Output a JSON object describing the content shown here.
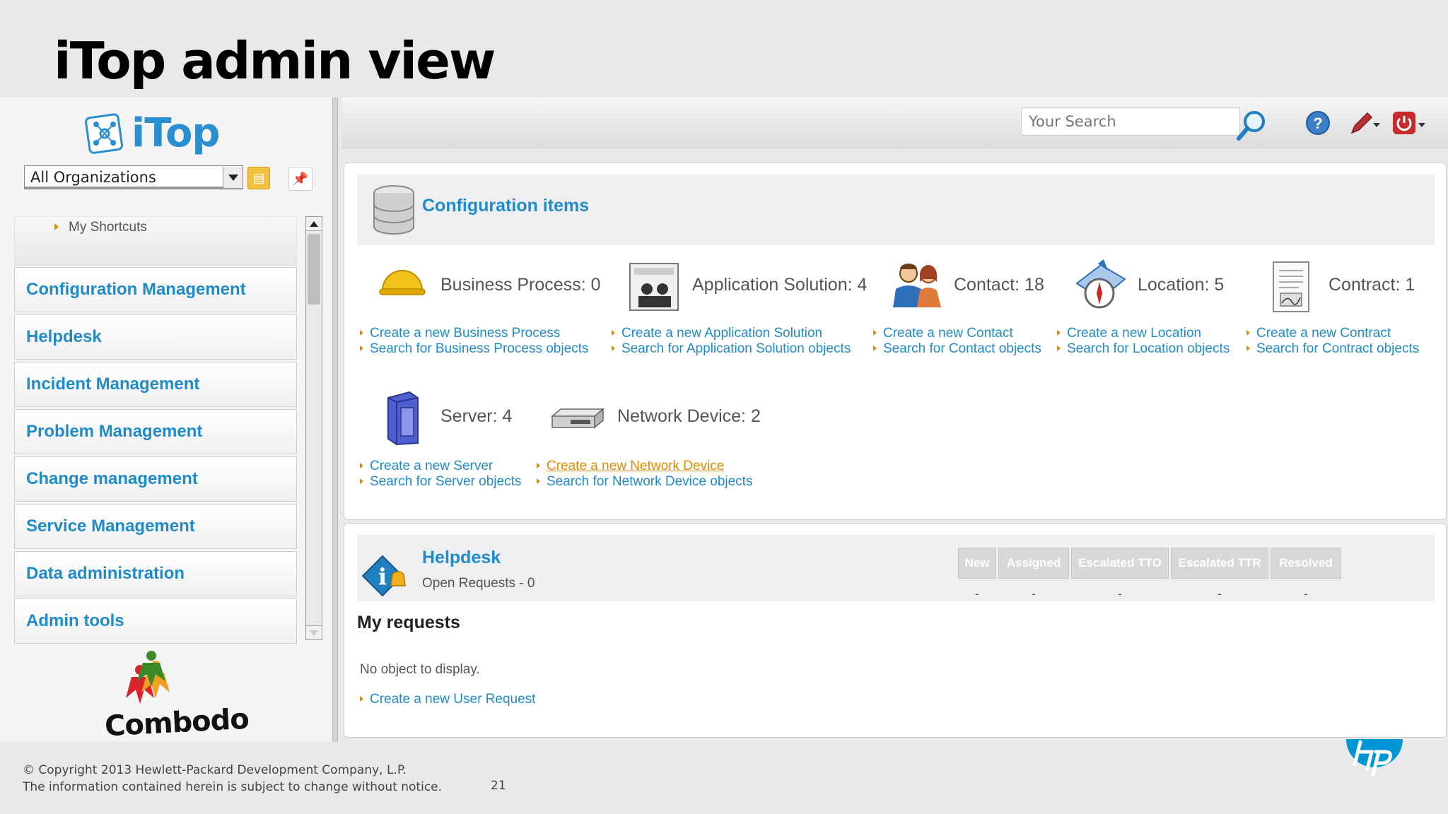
{
  "slide": {
    "title": "iTop admin view",
    "copyright": "© Copyright 2013 Hewlett-Packard Development Company, L.P.",
    "notice": "The information contained herein is subject to change without notice.",
    "page_number": "21"
  },
  "left_pane": {
    "logo_text": "iTop",
    "org_select": "All Organizations",
    "shortcuts_label": "My Shortcuts",
    "menu": [
      {
        "label": "Configuration Management"
      },
      {
        "label": "Helpdesk"
      },
      {
        "label": "Incident Management"
      },
      {
        "label": "Problem Management"
      },
      {
        "label": "Change management"
      },
      {
        "label": "Service Management"
      },
      {
        "label": "Data administration"
      },
      {
        "label": "Admin tools"
      }
    ],
    "combodo_text": "Combodo"
  },
  "topbar": {
    "search_placeholder": "Your Search"
  },
  "config_items": {
    "title": "Configuration items",
    "items": [
      {
        "label": "Business Process: 0",
        "create": "Create a new Business Process",
        "search": "Search for Business Process objects"
      },
      {
        "label": "Application Solution: 4",
        "create": "Create a new Application Solution",
        "search": "Search for Application Solution objects"
      },
      {
        "label": "Contact: 18",
        "create": "Create a new Contact",
        "search": "Search for Contact objects"
      },
      {
        "label": "Location: 5",
        "create": "Create a new Location",
        "search": "Search for Location objects"
      },
      {
        "label": "Contract: 1",
        "create": "Create a new Contract",
        "search": "Search for Contract objects"
      },
      {
        "label": "Server: 4",
        "create": "Create a new Server",
        "search": "Search for Server objects"
      },
      {
        "label": "Network Device: 2",
        "create": "Create a new Network Device",
        "search": "Search for Network Device objects"
      }
    ]
  },
  "helpdesk": {
    "title": "Helpdesk",
    "subtitle": "Open Requests - 0",
    "columns": [
      "New",
      "Assigned",
      "Escalated TTO",
      "Escalated TTR",
      "Resolved"
    ],
    "values": [
      "-",
      "-",
      "-",
      "-",
      "-"
    ],
    "my_requests": "My requests",
    "no_object": "No object to display.",
    "create_request": "Create a new User Request"
  },
  "colors": {
    "link_blue": "#1f8bc8",
    "accent_orange": "#e08a00",
    "hp_blue": "#0096d6"
  }
}
